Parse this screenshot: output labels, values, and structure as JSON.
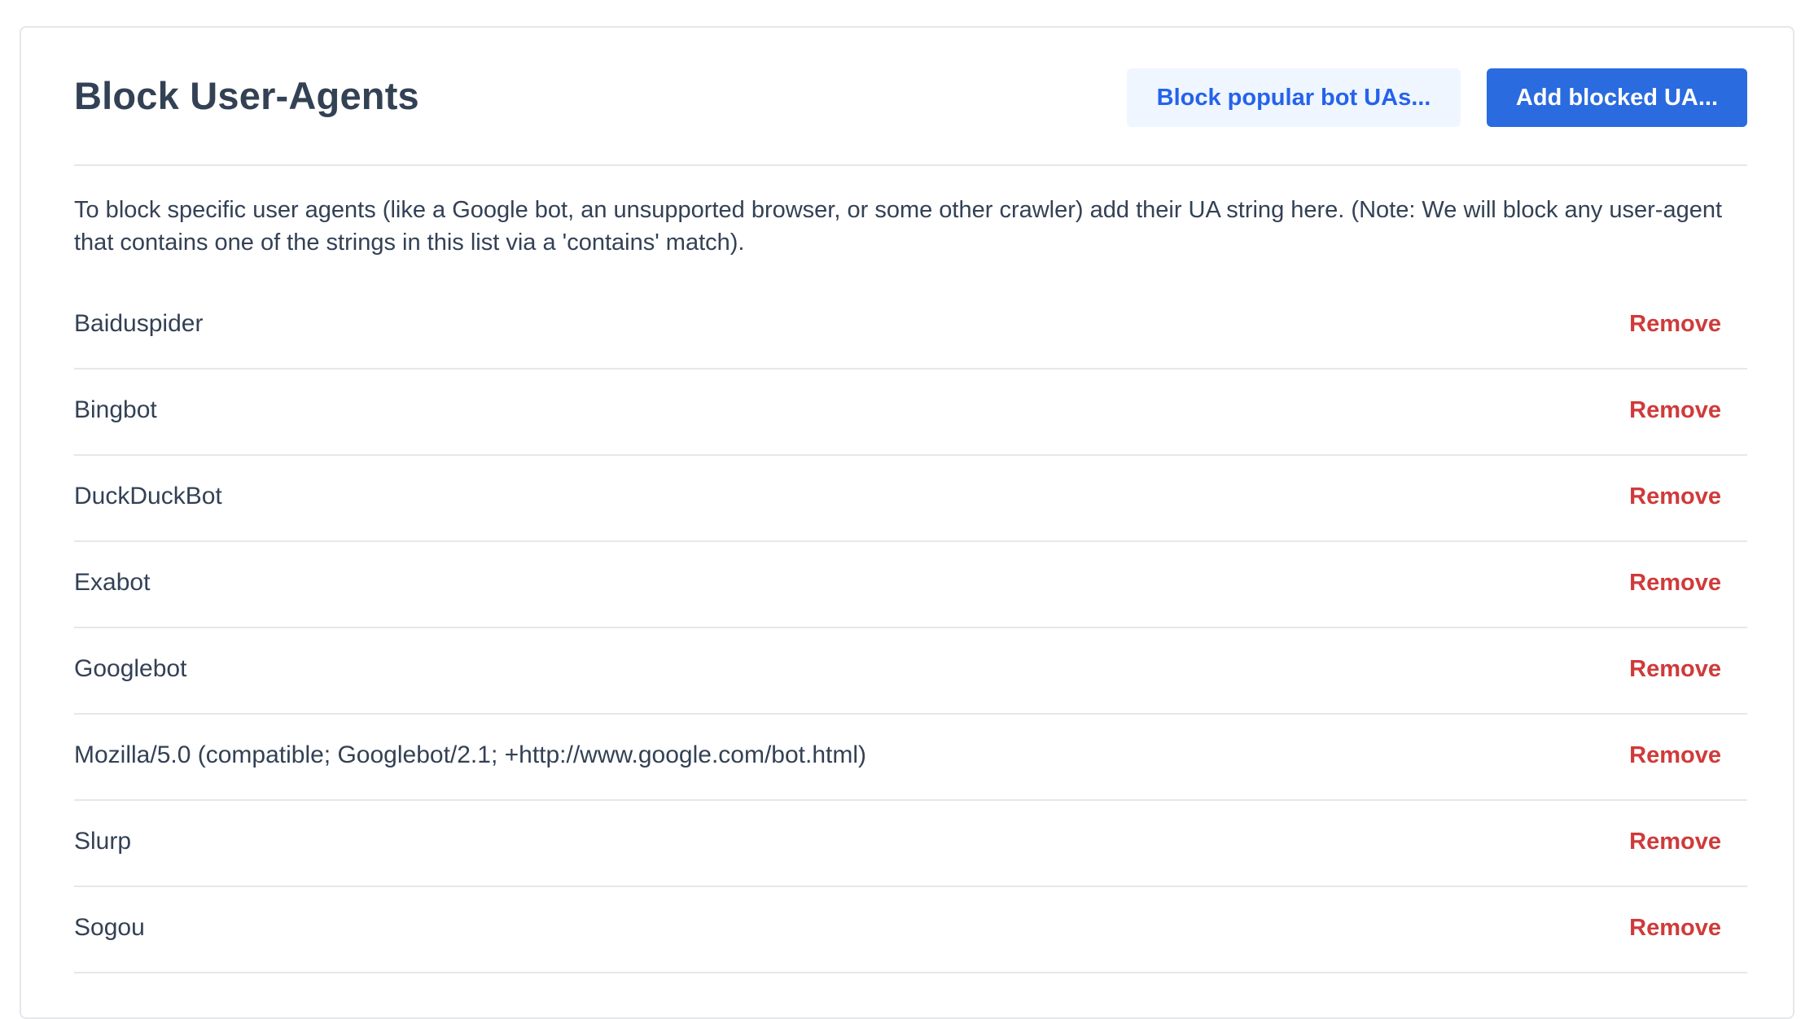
{
  "header": {
    "title": "Block User-Agents",
    "block_popular_label": "Block popular bot UAs...",
    "add_blocked_label": "Add blocked UA..."
  },
  "description": "To block specific user agents (like a Google bot, an unsupported browser, or some other crawler) add their UA string here. (Note: We will block any user-agent that contains one of the strings in this list via a 'contains' match).",
  "user_agents": [
    {
      "name": "Baiduspider",
      "action": "Remove"
    },
    {
      "name": "Bingbot",
      "action": "Remove"
    },
    {
      "name": "DuckDuckBot",
      "action": "Remove"
    },
    {
      "name": "Exabot",
      "action": "Remove"
    },
    {
      "name": "Googlebot",
      "action": "Remove"
    },
    {
      "name": "Mozilla/5.0 (compatible; Googlebot/2.1; +http://www.google.com/bot.html)",
      "action": "Remove"
    },
    {
      "name": "Slurp",
      "action": "Remove"
    },
    {
      "name": "Sogou",
      "action": "Remove"
    }
  ],
  "colors": {
    "primary": "#2a6be0",
    "secondary_bg": "#eff6ff",
    "danger": "#d03a3a",
    "text": "#334155"
  }
}
